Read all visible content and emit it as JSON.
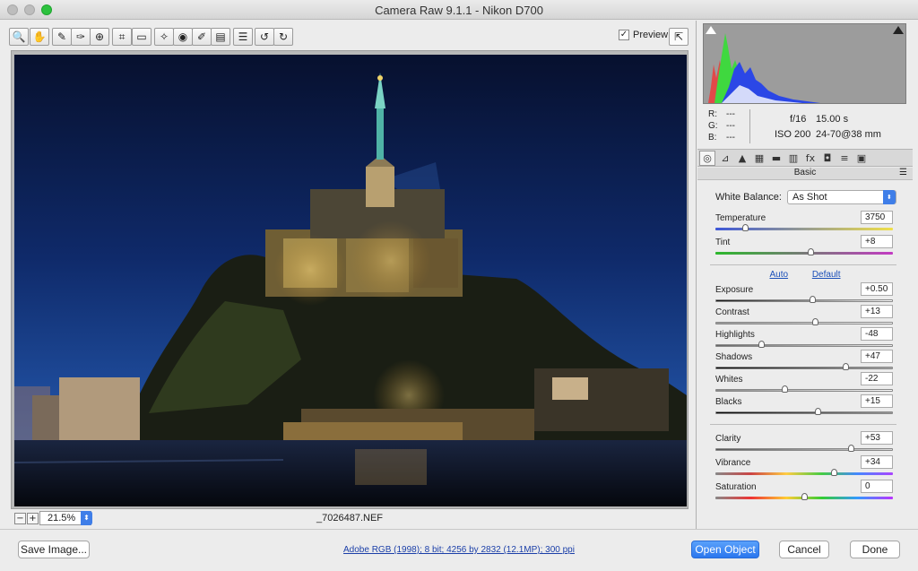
{
  "window": {
    "title": "Camera Raw 9.1.1  -  Nikon D700"
  },
  "toolbar": {
    "tools": [
      {
        "name": "zoom-tool-icon",
        "glyph": "🔍"
      },
      {
        "name": "hand-tool-icon",
        "glyph": "✋"
      },
      {
        "name": "white-balance-tool-icon",
        "glyph": "✎"
      },
      {
        "name": "color-sampler-tool-icon",
        "glyph": "✑"
      },
      {
        "name": "targeted-adjustment-tool-icon",
        "glyph": "⊕"
      },
      {
        "name": "crop-tool-icon",
        "glyph": "⌗"
      },
      {
        "name": "straighten-tool-icon",
        "glyph": "▭"
      },
      {
        "name": "spot-removal-tool-icon",
        "glyph": "✧"
      },
      {
        "name": "red-eye-tool-icon",
        "glyph": "◉"
      },
      {
        "name": "adjustment-brush-icon",
        "glyph": "✐"
      },
      {
        "name": "graduated-filter-icon",
        "glyph": "▤"
      },
      {
        "name": "preferences-icon",
        "glyph": "☰"
      },
      {
        "name": "rotate-left-icon",
        "glyph": "↺"
      },
      {
        "name": "rotate-right-icon",
        "glyph": "↻"
      }
    ],
    "preview_label": "Preview",
    "preview_checked": "✓",
    "fullscreen_glyph": "⇱"
  },
  "image": {
    "zoom_level": "21.5%",
    "filename": "_7026487.NEF"
  },
  "readout": {
    "r_label": "R:",
    "g_label": "G:",
    "b_label": "B:",
    "r_value": "---",
    "g_value": "---",
    "b_value": "---",
    "aperture": "f/16",
    "shutter": "15.00 s",
    "iso": "ISO 200",
    "lens": "24-70@38 mm"
  },
  "panel": {
    "name": "Basic",
    "menu_glyph": "☰",
    "tabs": [
      "◎",
      "⊿",
      "▲",
      "▦",
      "▬",
      "▥",
      "fx",
      "◘",
      "≡",
      "▣"
    ],
    "white_balance_label": "White Balance:",
    "white_balance_value": "As Shot",
    "auto_label": "Auto",
    "default_label": "Default",
    "sliders": {
      "temperature": {
        "label": "Temperature",
        "value": "3750"
      },
      "tint": {
        "label": "Tint",
        "value": "+8"
      },
      "exposure": {
        "label": "Exposure",
        "value": "+0.50"
      },
      "contrast": {
        "label": "Contrast",
        "value": "+13"
      },
      "highlights": {
        "label": "Highlights",
        "value": "-48"
      },
      "shadows": {
        "label": "Shadows",
        "value": "+47"
      },
      "whites": {
        "label": "Whites",
        "value": "-22"
      },
      "blacks": {
        "label": "Blacks",
        "value": "+15"
      },
      "clarity": {
        "label": "Clarity",
        "value": "+53"
      },
      "vibrance": {
        "label": "Vibrance",
        "value": "+34"
      },
      "saturation": {
        "label": "Saturation",
        "value": "0"
      }
    }
  },
  "footer": {
    "save_label": "Save Image...",
    "workflow_text": "Adobe RGB (1998); 8 bit; 4256 by 2832 (12.1MP); 300 ppi",
    "open_label": "Open Object",
    "cancel_label": "Cancel",
    "done_label": "Done"
  }
}
